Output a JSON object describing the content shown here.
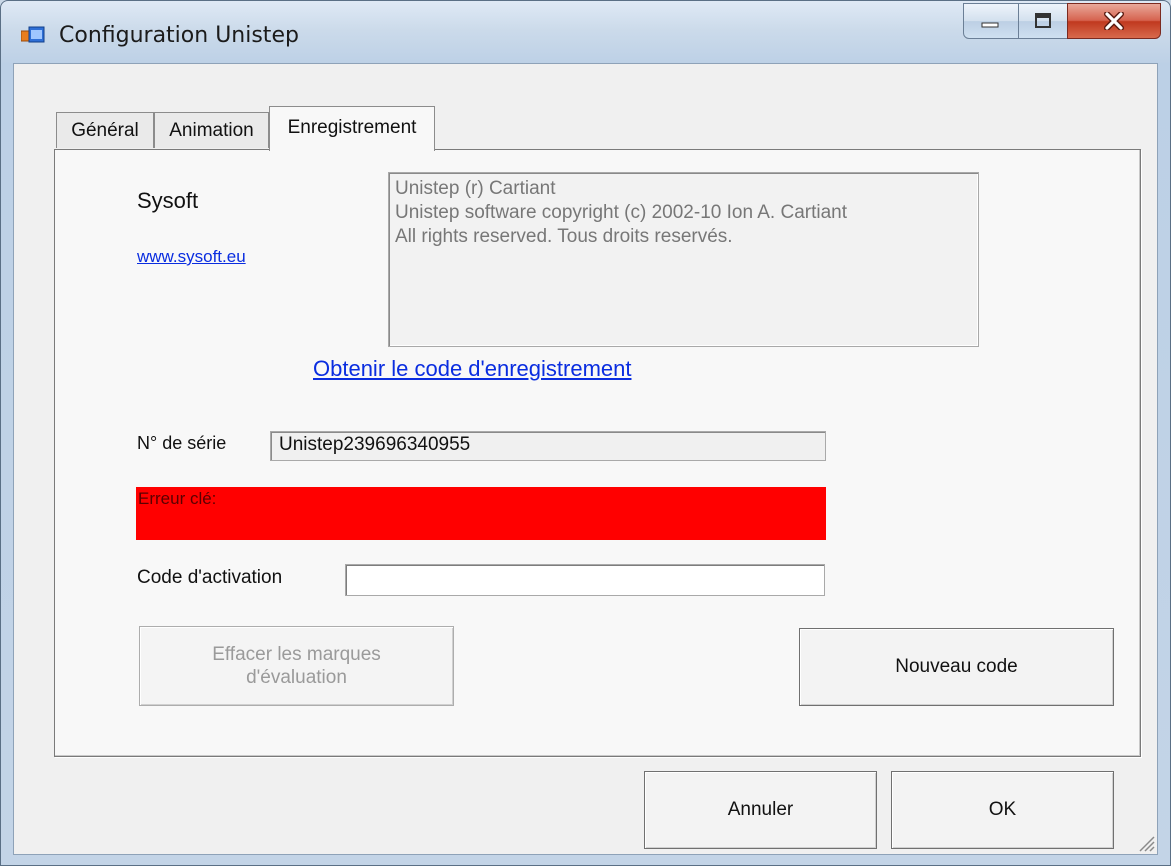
{
  "window": {
    "title": "Configuration Unistep"
  },
  "tabs": [
    {
      "label": "Général",
      "active": false
    },
    {
      "label": "Animation",
      "active": false
    },
    {
      "label": "Enregistrement",
      "active": true
    }
  ],
  "registration": {
    "company": "Sysoft",
    "website": "www.sysoft.eu",
    "info_lines": [
      "Unistep (r) Cartiant",
      "Unistep software copyright (c) 2002-10 Ion A. Cartiant",
      "All rights reserved. Tous droits reservés."
    ],
    "get_code_link": "Obtenir le code d'enregistrement",
    "serial_label": "N° de série",
    "serial_value": "Unistep239696340955",
    "error_text": "Erreur clé:",
    "activation_label": "Code d'activation",
    "activation_value": "",
    "clear_trial_button": "Effacer les marques d'évaluation",
    "new_code_button": "Nouveau code"
  },
  "footer": {
    "cancel_button": "Annuler",
    "ok_button": "OK"
  },
  "colors": {
    "error_background": "#ff0000",
    "link": "#0a2de0"
  }
}
